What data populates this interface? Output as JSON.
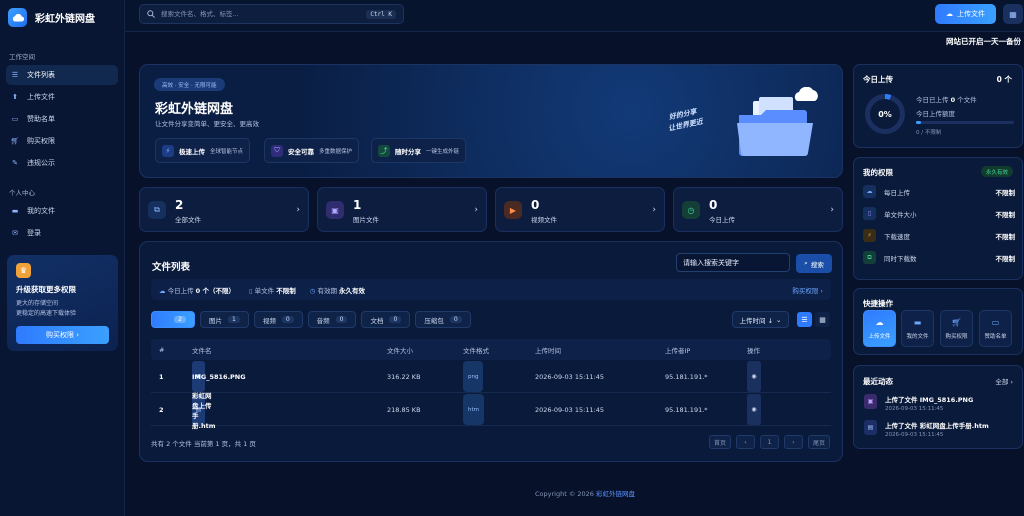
{
  "app": {
    "name": "彩虹外链网盘",
    "accent": "#2f7bff"
  },
  "sidebar": {
    "section_work": "工作空间",
    "work_items": [
      {
        "label": "文件列表",
        "icon": "list-icon"
      },
      {
        "label": "上传文件",
        "icon": "upload-icon"
      },
      {
        "label": "赞助名单",
        "icon": "sponsor-icon"
      },
      {
        "label": "购买权限",
        "icon": "cart-icon"
      },
      {
        "label": "违规公示",
        "icon": "gavel-icon"
      }
    ],
    "section_personal": "个人中心",
    "personal_items": [
      {
        "label": "我的文件",
        "icon": "folder-icon"
      },
      {
        "label": "登录",
        "icon": "mail-icon"
      }
    ],
    "promo": {
      "title": "升级获取更多权限",
      "desc_line1": "更大的存储空间",
      "desc_line2": "更稳定的高速下载体验",
      "button": "购买权限 ›"
    }
  },
  "topbar": {
    "search_placeholder": "搜索文件名、格式、标签...",
    "shortcut": "Ctrl K",
    "upload_label": "上传文件",
    "marquee": "网站已开启一天一备份"
  },
  "hero": {
    "badge": "高效 · 安全 · 无限可能",
    "title": "彩虹外链网盘",
    "subtitle": "让文件分享变简单、更安全、更高效",
    "slogan_line1": "好的分享",
    "slogan_line2": "让世界更近",
    "features": [
      {
        "title": "极速上传",
        "desc": "全球智能节点",
        "icon": "bolt-icon",
        "color": "#3a7bff"
      },
      {
        "title": "安全可靠",
        "desc": "多重数据保护",
        "icon": "shield-icon",
        "color": "#7a6bff"
      },
      {
        "title": "随时分享",
        "desc": "一键生成外链",
        "icon": "share-icon",
        "color": "#24b37a"
      }
    ]
  },
  "stats": [
    {
      "value": "2",
      "label": "全部文件",
      "icon": "files-icon",
      "color": "#2f5bc4"
    },
    {
      "value": "1",
      "label": "图片文件",
      "icon": "image-icon",
      "color": "#5b4bc4"
    },
    {
      "value": "0",
      "label": "视频文件",
      "icon": "video-icon",
      "color": "#c4642f"
    },
    {
      "value": "0",
      "label": "今日上传",
      "icon": "clock-icon",
      "color": "#1f8a6e"
    }
  ],
  "files": {
    "title": "文件列表",
    "search_placeholder": "请输入搜索关键字",
    "search_button": "搜索",
    "quota": {
      "today_label": "今日上传",
      "today_value": "0 个（不限）",
      "single_label": "单文件",
      "single_value": "不限制",
      "valid_label": "有效期",
      "valid_value": "永久有效",
      "buy": "购买权限 ›"
    },
    "filters": [
      {
        "label": "",
        "count": "2"
      },
      {
        "label": "图片",
        "count": "1"
      },
      {
        "label": "视频",
        "count": "0"
      },
      {
        "label": "音频",
        "count": "0"
      },
      {
        "label": "文档",
        "count": "0"
      },
      {
        "label": "压缩包",
        "count": "0"
      }
    ],
    "sort_label": "上传时间 ↓",
    "columns": [
      "#",
      "文件名",
      "文件大小",
      "文件格式",
      "上传时间",
      "上传者IP",
      "操作"
    ],
    "rows": [
      {
        "index": "1",
        "name": "IMG_5816.PNG",
        "size": "316.22 KB",
        "format": "png",
        "time": "2026-09-03 15:11:45",
        "ip": "95.181.191.*"
      },
      {
        "index": "2",
        "name": "彩虹网盘上传手册.htm",
        "size": "218.85 KB",
        "format": "htm",
        "time": "2026-09-03 15:11:45",
        "ip": "95.181.191.*"
      }
    ],
    "pager_info": "共有 2 个文件  当前第 1 页，共 1 页",
    "pager": [
      "首页",
      "‹",
      "1",
      "›",
      "尾页"
    ]
  },
  "footer": {
    "prefix": "Copyright © 2026 ",
    "link": "彩虹外链网盘"
  },
  "today": {
    "title": "今日上传",
    "count": "0 个",
    "percent_label": "0%",
    "progress_percent": 5,
    "line1_prefix": "今日已上传 ",
    "line1_value": "0",
    "line1_suffix": " 个文件",
    "line2": "今日上传额度",
    "line3": "0 / 不限制"
  },
  "permissions": {
    "title": "我的权限",
    "badge": "永久有效",
    "items": [
      {
        "label": "每日上传",
        "value": "不限制",
        "icon": "cloud-icon"
      },
      {
        "label": "单文件大小",
        "value": "不限制",
        "icon": "file-icon"
      },
      {
        "label": "下载速度",
        "value": "不限制",
        "icon": "bolt-icon"
      },
      {
        "label": "同时下载数",
        "value": "不限制",
        "icon": "copy-icon"
      }
    ]
  },
  "quick": {
    "title": "快捷操作",
    "items": [
      {
        "label": "上传文件",
        "icon": "cloud-upload-icon"
      },
      {
        "label": "我的文件",
        "icon": "folder-icon"
      },
      {
        "label": "购买权限",
        "icon": "cart-icon"
      },
      {
        "label": "赞助名单",
        "icon": "sponsor-icon"
      }
    ]
  },
  "recent": {
    "title": "最近动态",
    "all": "全部 ›",
    "items": [
      {
        "text": "上传了文件 IMG_5816.PNG",
        "time": "2026-09-03 15:11:45"
      },
      {
        "text": "上传了文件 彩虹网盘上传手册.htm",
        "time": "2026-09-03 15:11:45"
      }
    ]
  }
}
